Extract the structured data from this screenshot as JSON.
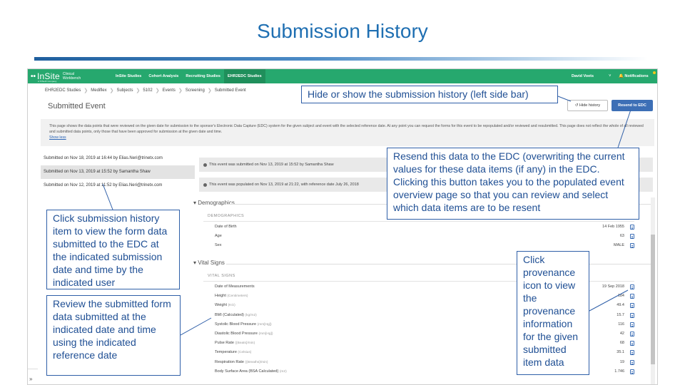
{
  "slide": {
    "title": "Submission History"
  },
  "app": {
    "logo": {
      "mark": "••",
      "name": "InSite",
      "sub_line1": "Clinical",
      "sub_line2": "Workbench",
      "tag": "A TriNetX Company"
    },
    "nav": [
      "InSite Studies",
      "Cohort Analysis",
      "Recruiting Studies",
      "EHR2EDC Studies"
    ],
    "user": "David Voets",
    "user_caret": "˅",
    "notifications": "🔔 Notifications",
    "breadcrumbs": [
      "EHR2EDC Studies",
      "Mediflex",
      "Subjects",
      "5102",
      "Events",
      "Screening",
      "Submitted Event"
    ],
    "breadcrumb_sep": "❯",
    "page_title": "Submitted Event",
    "hide_history_label": "↺ Hide history",
    "resend_label": "Resend to EDC",
    "description": "This page shows the data points that were reviewed on the given date for submission to the sponsor's Electronic Data Capture (EDC) system for the given subject and event with the selected reference date. At any point you can request the forms for this event to be repopulated and/or reviewed and resubmitted. This page does not reflect the whole of all reviewed and submitted data points, only those that have been approved for submission at the given date and time.",
    "show_less": "Show less",
    "history": [
      "Submitted on Nov 18, 2019 at 16:44 by Elias.Neri@trinetx.com",
      "Submitted on Nov 13, 2019 at 15:52 by Samantha Shaw",
      "Submitted on Nov 12, 2019 at 11:52 by Elias.Neri@trinetx.com"
    ],
    "info_bars": [
      "This event was submitted on Nov 13, 2019 at 15:52 by Samantha Shaw",
      "This event was populated on Nov 13, 2019 at 21:22, with reference date July 26, 2018"
    ],
    "expand_toggle": "»",
    "sections": {
      "demographics": {
        "title": "▾ Demographics",
        "sub": "DEMOGRAPHICS",
        "fields": [
          {
            "label": "Date of Birth",
            "unit": "",
            "value": "14 Feb 1955"
          },
          {
            "label": "Age",
            "unit": "",
            "value": "63"
          },
          {
            "label": "Sex",
            "unit": "",
            "value": "MALE"
          }
        ]
      },
      "vitals": {
        "title": "▾ Vital Signs",
        "sub": "VITAL SIGNS",
        "fields": [
          {
            "label": "Date of Measurements",
            "unit": "",
            "value": "19 Sep 2018"
          },
          {
            "label": "Height",
            "unit": "(Centimeters)",
            "value": "184"
          },
          {
            "label": "Weight",
            "unit": "(KG)",
            "value": "49.4"
          },
          {
            "label": "BMI (Calculated)",
            "unit": "(kg/m2)",
            "value": "15.7"
          },
          {
            "label": "Systolic Blood Pressure",
            "unit": "(mm[Hg])",
            "value": "116"
          },
          {
            "label": "Diastolic Blood Pressure",
            "unit": "(mm[Hg])",
            "value": "42"
          },
          {
            "label": "Pulse Rate",
            "unit": "({Beats}/min)",
            "value": "68"
          },
          {
            "label": "Temperature",
            "unit": "(Celsius)",
            "value": "35.1"
          },
          {
            "label": "Respiration Rate",
            "unit": "({Breaths}/min)",
            "value": "19"
          },
          {
            "label": "Body Surface Area (BSA Calculated)",
            "unit": "(m2)",
            "value": "1.746"
          }
        ]
      }
    }
  },
  "callouts": {
    "hide": "Hide or show the submission history (left side bar)",
    "resend": "Resend this data to the EDC (overwriting the current values for these data items (if any) in the EDC. Clicking this button takes you to the populated event overview page so that you can review and select which data items are to be resent",
    "click_item": "Click submission history item to view the form data submitted to the EDC at the indicated submission date and time by the indicated user",
    "review": "Review the submitted form data submitted at the indicated date and time using the indicated reference date",
    "provenance": "Click provenance icon to view the provenance information for the given submitted item data"
  },
  "colors": {
    "title": "#1f6fb2",
    "topbar": "#26a86e",
    "resend_button": "#3d6fb6",
    "callout_border": "#2f5fa8"
  }
}
